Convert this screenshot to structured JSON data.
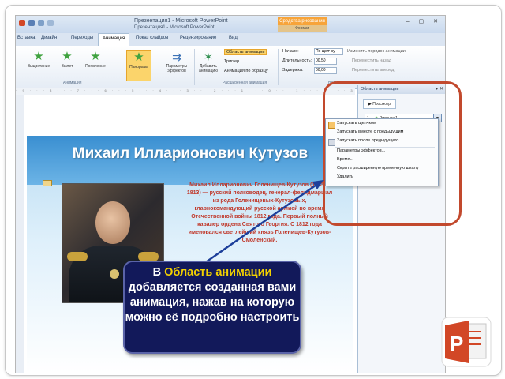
{
  "window": {
    "title": "Презентация1 - Microsoft PowerPoint",
    "subtitle": "Презентация1 - Microsoft PowerPoint",
    "tool_tab_top": "Средства рисования",
    "tool_tab_bottom": "Формат",
    "controls": "– ▢ ✕",
    "doc_controls": "– ▢ ✕ ?"
  },
  "tabs": [
    "Вставка",
    "Дизайн",
    "Переходы",
    "Анимация",
    "Показ слайдов",
    "Рецензирование",
    "Вид"
  ],
  "ribbon": {
    "effects": [
      "Выцветание",
      "Вылет",
      "Появление",
      "Панорама"
    ],
    "group_animation_label": "Анимация",
    "effect_params_label": "Параметры эффектов",
    "add_animation_label": "Добавить анимацию",
    "pane_toggle": "Область анимации",
    "trigger": "Триггер",
    "anim_painter": "Анимация по образцу",
    "group_extended_label": "Расширенная анимация",
    "start_label": "Начало:",
    "start_value": "По щелчку",
    "duration_label": "Длительность:",
    "duration_value": "00,50",
    "delay_label": "Задержка:",
    "delay_value": "00,00",
    "reorder_label": "Изменить порядок анимации",
    "move_earlier": "Переместить назад",
    "move_later": "Переместить вперед",
    "group_timing_label": "Время показа слайдов"
  },
  "slide": {
    "title": "Михаил Илларионович Кутузов",
    "bio": "Михаил Илларионович Голенищев-Кутузов (1745—1813) — русский полководец, генерал-фельдмаршал из рода Голенищевых-Кутузовых, главнокомандующий русской армией во время Отечественной войны 1812 года. Первый полный кавалер ордена Святого Георгия. С 1812 года именовался светлейший князь Голенищев-Кутузов-Смоленский."
  },
  "animation_pane": {
    "header": "Область анимации",
    "preview_button": "Просмотр",
    "item_number": "1",
    "item_label": "Рисунок 1"
  },
  "context_menu": {
    "items": [
      "Запускать щелчком",
      "Запускать вместе с предыдущим",
      "Запускать после предыдущего",
      "Параметры эффектов...",
      "Время...",
      "Скрыть расширенную временную шкалу",
      "Удалить"
    ]
  },
  "callout": {
    "prefix": "В",
    "highlight": "Область анимации",
    "rest": "добавляется созданная вами анимация, нажав на которую можно её подробно настроить"
  },
  "colors": {
    "accent_orange": "#c2492d",
    "callout_bg": "#12195a",
    "callout_highlight": "#f2d000",
    "bio_text": "#c0392b"
  }
}
